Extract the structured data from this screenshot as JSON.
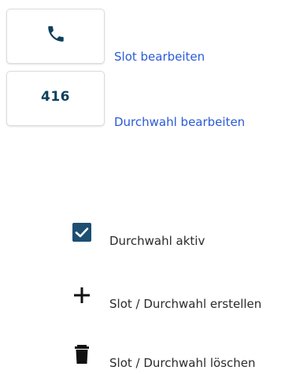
{
  "tiles": {
    "slot": {
      "icon": "phone-icon",
      "icon_color": "#0f3f5c"
    },
    "extension": {
      "number": "416"
    }
  },
  "links": {
    "edit_slot": "Slot bearbeiten",
    "edit_extension": "Durchwahl bearbeiten"
  },
  "legend": {
    "active": {
      "icon": "checkbox-checked-icon",
      "label": "Durchwahl aktiv"
    },
    "create": {
      "icon": "plus-icon",
      "label": "Slot / Durchwahl erstellen"
    },
    "delete": {
      "icon": "trash-icon",
      "label": "Slot / Durchwahl löschen"
    }
  },
  "colors": {
    "accent": "#0f3f5c",
    "checkbox": "#1d4f73",
    "link": "#2a5bd7",
    "text": "#2b2b2b"
  }
}
